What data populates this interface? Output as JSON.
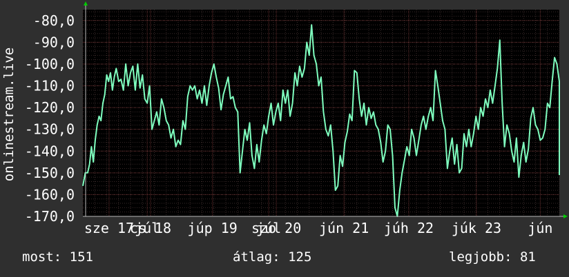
{
  "colors": {
    "background": "#2f2f2f",
    "plot_background": "#000000",
    "grid_major": "#6a2f2f",
    "grid_minor": "#3a2a2a",
    "line": "#7fffbf",
    "text": "#ffffff",
    "axis_arrow": "#00cc00"
  },
  "stats": {
    "now": "most: 151",
    "avg": "átlag: 125",
    "best": "legjobb: 81"
  },
  "chart_data": {
    "type": "line",
    "title": "",
    "xlabel": "",
    "ylabel": "onlinestream.live",
    "ylim": [
      -170,
      -75
    ],
    "y_ticks": [
      {
        "value": -80,
        "label": "-80,0"
      },
      {
        "value": -90,
        "label": "-90,0"
      },
      {
        "value": -100,
        "label": "-100,0"
      },
      {
        "value": -110,
        "label": "-110,0"
      },
      {
        "value": -120,
        "label": "-120,0"
      },
      {
        "value": -130,
        "label": "-130,0"
      },
      {
        "value": -140,
        "label": "-140,0"
      },
      {
        "value": -150,
        "label": "-150,0"
      },
      {
        "value": -160,
        "label": "-160,0"
      },
      {
        "value": -170,
        "label": "-170,0"
      }
    ],
    "x_range": [
      0,
      100
    ],
    "x_ticks": [
      {
        "x": 5.5,
        "label": "sze 17"
      },
      {
        "x": 13.5,
        "label": "júl"
      },
      {
        "x": 14.2,
        "label": "cs 18"
      },
      {
        "x": 27.2,
        "label": "júp 19"
      },
      {
        "x": 39.0,
        "label": "júl"
      },
      {
        "x": 40.6,
        "label": "szo 20"
      },
      {
        "x": 54.8,
        "label": "jún 21"
      },
      {
        "x": 68.4,
        "label": "júh 22"
      },
      {
        "x": 82.6,
        "label": "júk 23"
      },
      {
        "x": 96.0,
        "label": "jún"
      }
    ],
    "grid": true,
    "series": [
      {
        "values": [
          [
            0,
            -156
          ],
          [
            0.5,
            -150
          ],
          [
            1,
            -150
          ],
          [
            1.4,
            -146
          ],
          [
            1.8,
            -138
          ],
          [
            2.2,
            -145
          ],
          [
            2.6,
            -135
          ],
          [
            3,
            -128
          ],
          [
            3.4,
            -124
          ],
          [
            3.8,
            -126
          ],
          [
            4.2,
            -118
          ],
          [
            4.6,
            -114
          ],
          [
            5,
            -105
          ],
          [
            5.4,
            -108
          ],
          [
            5.8,
            -104
          ],
          [
            6.2,
            -112
          ],
          [
            6.6,
            -106
          ],
          [
            7,
            -102
          ],
          [
            7.5,
            -108
          ],
          [
            8,
            -107
          ],
          [
            8.5,
            -112
          ],
          [
            9,
            -100
          ],
          [
            9.5,
            -110
          ],
          [
            10,
            -104
          ],
          [
            10.5,
            -101
          ],
          [
            11,
            -112
          ],
          [
            11.5,
            -100
          ],
          [
            12,
            -111
          ],
          [
            12.5,
            -105
          ],
          [
            13,
            -116
          ],
          [
            13.5,
            -118
          ],
          [
            14,
            -110
          ],
          [
            14.5,
            -130
          ],
          [
            15,
            -126
          ],
          [
            15.5,
            -122
          ],
          [
            16,
            -128
          ],
          [
            16.5,
            -116
          ],
          [
            17,
            -120
          ],
          [
            17.5,
            -126
          ],
          [
            18,
            -128
          ],
          [
            18.5,
            -134
          ],
          [
            19,
            -130
          ],
          [
            19.5,
            -138
          ],
          [
            20,
            -135
          ],
          [
            20.5,
            -137
          ],
          [
            21,
            -126
          ],
          [
            21.5,
            -130
          ],
          [
            22,
            -115
          ],
          [
            22.5,
            -110
          ],
          [
            23,
            -112
          ],
          [
            23.5,
            -110
          ],
          [
            24,
            -116
          ],
          [
            24.5,
            -112
          ],
          [
            25,
            -118
          ],
          [
            25.5,
            -110
          ],
          [
            26,
            -119
          ],
          [
            26.5,
            -110
          ],
          [
            27,
            -104
          ],
          [
            27.5,
            -100
          ],
          [
            28,
            -106
          ],
          [
            28.5,
            -111
          ],
          [
            29,
            -121
          ],
          [
            29.5,
            -114
          ],
          [
            30,
            -110
          ],
          [
            30.5,
            -106
          ],
          [
            31,
            -116
          ],
          [
            31.5,
            -115
          ],
          [
            32,
            -120
          ],
          [
            32.5,
            -122
          ],
          [
            33,
            -150
          ],
          [
            33.5,
            -140
          ],
          [
            34,
            -130
          ],
          [
            34.5,
            -135
          ],
          [
            35,
            -127
          ],
          [
            35.5,
            -142
          ],
          [
            36,
            -148
          ],
          [
            36.5,
            -137
          ],
          [
            37,
            -145
          ],
          [
            37.5,
            -135
          ],
          [
            38,
            -128
          ],
          [
            38.5,
            -132
          ],
          [
            39,
            -124
          ],
          [
            39.5,
            -118
          ],
          [
            40,
            -128
          ],
          [
            40.5,
            -122
          ],
          [
            41,
            -118
          ],
          [
            41.5,
            -126
          ],
          [
            42,
            -112
          ],
          [
            42.5,
            -118
          ],
          [
            43,
            -112
          ],
          [
            43.5,
            -124
          ],
          [
            44,
            -118
          ],
          [
            44.5,
            -104
          ],
          [
            45,
            -110
          ],
          [
            45.5,
            -101
          ],
          [
            46,
            -106
          ],
          [
            46.5,
            -102
          ],
          [
            47,
            -90
          ],
          [
            47.5,
            -96
          ],
          [
            48,
            -82
          ],
          [
            48.5,
            -96
          ],
          [
            49,
            -100
          ],
          [
            49.5,
            -110
          ],
          [
            50,
            -106
          ],
          [
            50.5,
            -122
          ],
          [
            51,
            -130
          ],
          [
            51.5,
            -133
          ],
          [
            52,
            -128
          ],
          [
            52.5,
            -140
          ],
          [
            53,
            -158
          ],
          [
            53.5,
            -156
          ],
          [
            54,
            -142
          ],
          [
            54.5,
            -147
          ],
          [
            55,
            -136
          ],
          [
            55.5,
            -131
          ],
          [
            56,
            -123
          ],
          [
            56.5,
            -126
          ],
          [
            57,
            -103
          ],
          [
            57.5,
            -104
          ],
          [
            58,
            -116
          ],
          [
            58.5,
            -124
          ],
          [
            59,
            -118
          ],
          [
            59.5,
            -128
          ],
          [
            60,
            -120
          ],
          [
            60.5,
            -125
          ],
          [
            61,
            -122
          ],
          [
            61.5,
            -128
          ],
          [
            62,
            -130
          ],
          [
            62.5,
            -136
          ],
          [
            63,
            -145
          ],
          [
            63.5,
            -140
          ],
          [
            64,
            -128
          ],
          [
            64.5,
            -130
          ],
          [
            65,
            -142
          ],
          [
            65.5,
            -166
          ],
          [
            66,
            -170
          ],
          [
            66.5,
            -158
          ],
          [
            67,
            -150
          ],
          [
            67.5,
            -144
          ],
          [
            68,
            -138
          ],
          [
            68.5,
            -142
          ],
          [
            69,
            -130
          ],
          [
            69.5,
            -134
          ],
          [
            70,
            -142
          ],
          [
            70.5,
            -135
          ],
          [
            71,
            -128
          ],
          [
            71.5,
            -124
          ],
          [
            72,
            -130
          ],
          [
            72.5,
            -124
          ],
          [
            73,
            -120
          ],
          [
            73.5,
            -126
          ],
          [
            74,
            -103
          ],
          [
            74.5,
            -110
          ],
          [
            75,
            -118
          ],
          [
            75.5,
            -126
          ],
          [
            76,
            -130
          ],
          [
            76.5,
            -148
          ],
          [
            77,
            -140
          ],
          [
            77.5,
            -134
          ],
          [
            78,
            -146
          ],
          [
            78.5,
            -137
          ],
          [
            79,
            -150
          ],
          [
            79.5,
            -148
          ],
          [
            80,
            -132
          ],
          [
            80.5,
            -138
          ],
          [
            81,
            -130
          ],
          [
            81.5,
            -138
          ],
          [
            82,
            -132
          ],
          [
            82.5,
            -124
          ],
          [
            83,
            -130
          ],
          [
            83.5,
            -120
          ],
          [
            84,
            -124
          ],
          [
            84.5,
            -116
          ],
          [
            85,
            -120
          ],
          [
            85.5,
            -112
          ],
          [
            86,
            -118
          ],
          [
            86.5,
            -110
          ],
          [
            87,
            -102
          ],
          [
            87.5,
            -89
          ],
          [
            88,
            -118
          ],
          [
            88.5,
            -138
          ],
          [
            89,
            -128
          ],
          [
            89.5,
            -132
          ],
          [
            90,
            -140
          ],
          [
            90.5,
            -145
          ],
          [
            91,
            -134
          ],
          [
            91.5,
            -152
          ],
          [
            92,
            -142
          ],
          [
            92.5,
            -136
          ],
          [
            93,
            -145
          ],
          [
            93.5,
            -139
          ],
          [
            94,
            -125
          ],
          [
            94.5,
            -120
          ],
          [
            95,
            -128
          ],
          [
            95.5,
            -130
          ],
          [
            96,
            -135
          ],
          [
            96.5,
            -134
          ],
          [
            97,
            -130
          ],
          [
            97.5,
            -118
          ],
          [
            98,
            -120
          ],
          [
            98.5,
            -108
          ],
          [
            99,
            -97
          ],
          [
            99.5,
            -100
          ],
          [
            100,
            -108
          ],
          [
            100.5,
            -118
          ],
          [
            101,
            -150
          ],
          [
            101.5,
            -145
          ],
          [
            102,
            -140
          ],
          [
            102.5,
            -137
          ],
          [
            103,
            -148
          ],
          [
            103.5,
            -151
          ]
        ]
      }
    ]
  }
}
